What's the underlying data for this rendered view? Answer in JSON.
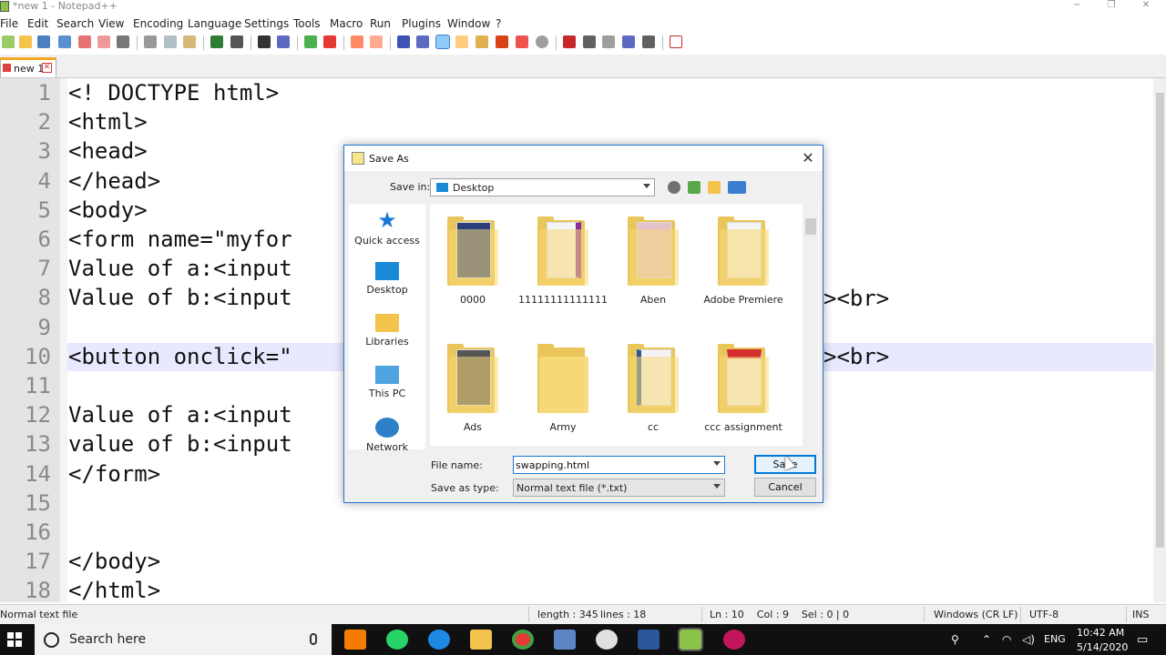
{
  "window": {
    "title": "*new 1 - Notepad++",
    "controls": [
      "−",
      "❐",
      "✕"
    ]
  },
  "menu": [
    "File",
    "Edit",
    "Search",
    "View",
    "Encoding",
    "Language",
    "Settings",
    "Tools",
    "Macro",
    "Run",
    "Plugins",
    "Window",
    "?"
  ],
  "tabs": [
    {
      "label": "new 1"
    }
  ],
  "editor": {
    "line_numbers": [
      "1",
      "2",
      "3",
      "4",
      "5",
      "6",
      "7",
      "8",
      "9",
      "10",
      "11",
      "12",
      "13",
      "14",
      "15",
      "16",
      "17",
      "18"
    ],
    "lines": [
      "<! DOCTYPE html>",
      "<html>",
      "<head>",
      "</head>",
      "<body>",
      "<form name=\"myfor",
      "Value of a:<input",
      "Value of b:<input",
      "",
      "<button onclick=\"",
      "",
      "Value of a:<input",
      "value of b:<input",
      "</form>",
      "",
      "",
      "</body>",
      "</html>"
    ],
    "line8_tail": "><br>",
    "line10_tail": "><br>",
    "current_line": 10
  },
  "status": {
    "filetype": "Normal text file",
    "length": "length : 345",
    "lines": "lines : 18",
    "pos": "Ln : 10    Col : 9    Sel : 0 | 0",
    "eol": "Windows (CR LF)",
    "encoding": "UTF-8",
    "mode": "INS"
  },
  "dialog": {
    "title": "Save As",
    "close": "✕",
    "save_in_label": "Save in:",
    "save_in_value": "Desktop",
    "places": [
      {
        "label": "Quick access"
      },
      {
        "label": "Desktop"
      },
      {
        "label": "Libraries"
      },
      {
        "label": "This PC"
      },
      {
        "label": "Network"
      }
    ],
    "files": [
      {
        "name": "0000"
      },
      {
        "name": "11111111111111"
      },
      {
        "name": "Aben"
      },
      {
        "name": "Adobe Premiere"
      },
      {
        "name": "Ads"
      },
      {
        "name": "Army"
      },
      {
        "name": "cc"
      },
      {
        "name": "ccc assignment"
      }
    ],
    "file_name_label": "File name:",
    "file_name_value": "swapping.html",
    "save_type_label": "Save as type:",
    "save_type_value": "Normal text file (*.txt)",
    "save_button": "Save",
    "cancel_button": "Cancel"
  },
  "taskbar": {
    "search_placeholder": "Search here",
    "lang": "ENG",
    "time": "10:42 AM",
    "date": "5/14/2020"
  }
}
